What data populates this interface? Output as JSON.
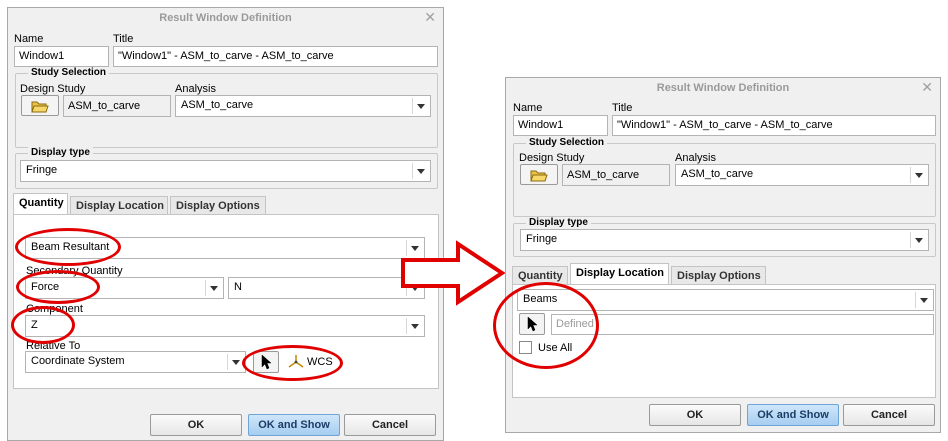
{
  "dialog_title": "Result Window Definition",
  "close_glyph": "✕",
  "name_label": "Name",
  "title_label": "Title",
  "name_value": "Window1",
  "title_value": "\"Window1\" - ASM_to_carve - ASM_to_carve",
  "study_selection_label": "Study Selection",
  "design_study_label": "Design Study",
  "design_study_value": "ASM_to_carve",
  "analysis_label": "Analysis",
  "analysis_value": "ASM_to_carve",
  "display_type_label": "Display type",
  "display_type_value": "Fringe",
  "tabs": {
    "quantity": "Quantity",
    "display_location": "Display Location",
    "display_options": "Display Options"
  },
  "left": {
    "quantity_value": "Beam Resultant",
    "secondary_quantity_label": "Secondary Quantity",
    "secondary_quantity_value": "Force",
    "secondary_unit_value": "N",
    "component_label": "Component",
    "component_value": "Z",
    "relative_to_label": "Relative To",
    "relative_to_value": "Coordinate System",
    "csys_value": "WCS"
  },
  "right": {
    "location_value": "Beams",
    "selection_placeholder": "Defined",
    "use_all_label": "Use All"
  },
  "buttons": {
    "ok": "OK",
    "ok_and_show": "OK and Show",
    "cancel": "Cancel"
  },
  "icons": [
    "close-icon",
    "folder-open-icon",
    "dropdown-arrow-icon",
    "select-cursor-icon",
    "coordinate-system-icon",
    "right-arrow-icon"
  ],
  "colors": {
    "annotation": "#e10000",
    "primary_button": "#a6cdf0",
    "dialog_bg": "#f0f0f0"
  }
}
